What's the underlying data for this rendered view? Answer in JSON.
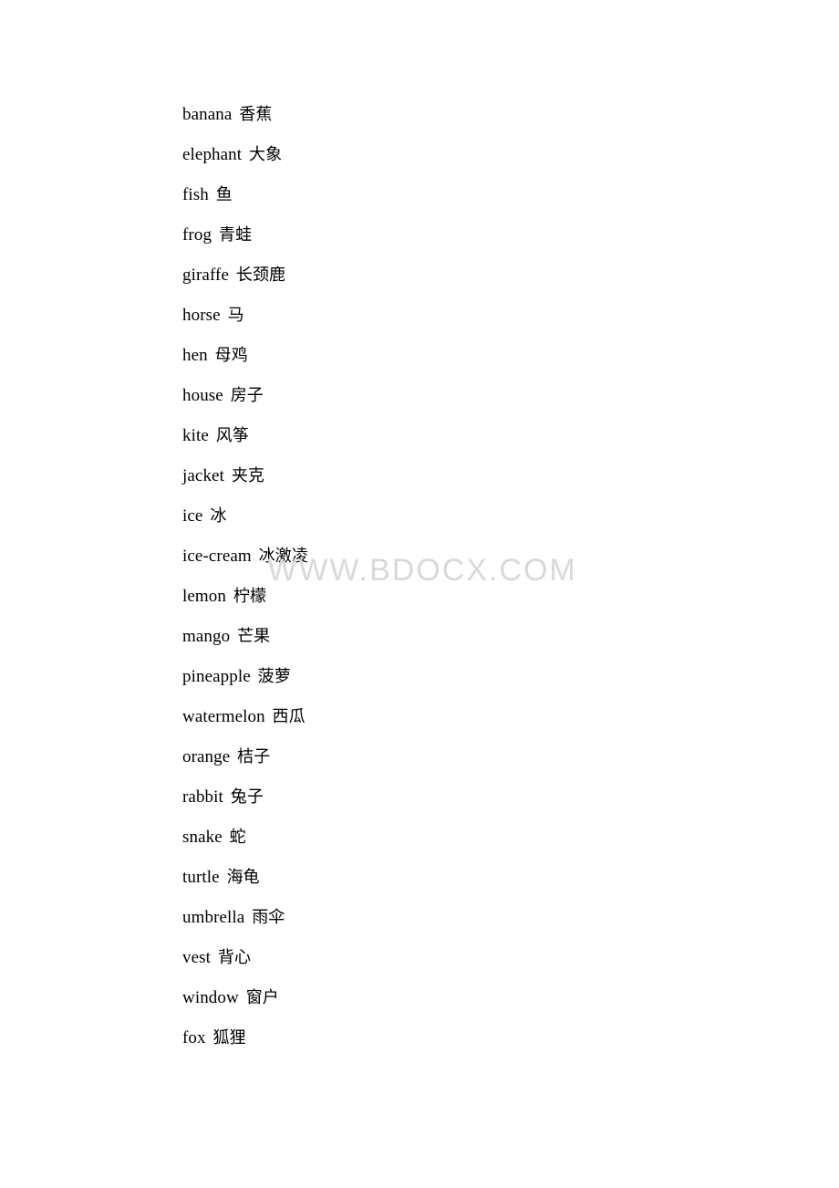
{
  "document": {
    "watermark": "WWW.BDOCX.COM",
    "entries": [
      {
        "en": "banana",
        "zh": "香蕉"
      },
      {
        "en": "elephant",
        "zh": "大象"
      },
      {
        "en": "fish",
        "zh": "鱼"
      },
      {
        "en": "frog",
        "zh": "青蛙"
      },
      {
        "en": "giraffe",
        "zh": "长颈鹿"
      },
      {
        "en": "horse",
        "zh": "马"
      },
      {
        "en": "hen",
        "zh": "母鸡"
      },
      {
        "en": "house",
        "zh": "房子"
      },
      {
        "en": "kite",
        "zh": "风筝"
      },
      {
        "en": "jacket",
        "zh": "夹克"
      },
      {
        "en": "ice",
        "zh": "冰"
      },
      {
        "en": "ice-cream",
        "zh": "冰激凌"
      },
      {
        "en": "lemon",
        "zh": "柠檬"
      },
      {
        "en": "mango",
        "zh": "芒果"
      },
      {
        "en": "pineapple",
        "zh": "菠萝"
      },
      {
        "en": "watermelon",
        "zh": "西瓜"
      },
      {
        "en": "orange",
        "zh": "桔子"
      },
      {
        "en": "rabbit",
        "zh": "兔子"
      },
      {
        "en": "snake",
        "zh": "蛇"
      },
      {
        "en": "turtle",
        "zh": "海龟"
      },
      {
        "en": "umbrella",
        "zh": "雨伞"
      },
      {
        "en": "vest",
        "zh": "背心"
      },
      {
        "en": "window",
        "zh": "窗户"
      },
      {
        "en": "fox",
        "zh": "狐狸"
      }
    ]
  }
}
